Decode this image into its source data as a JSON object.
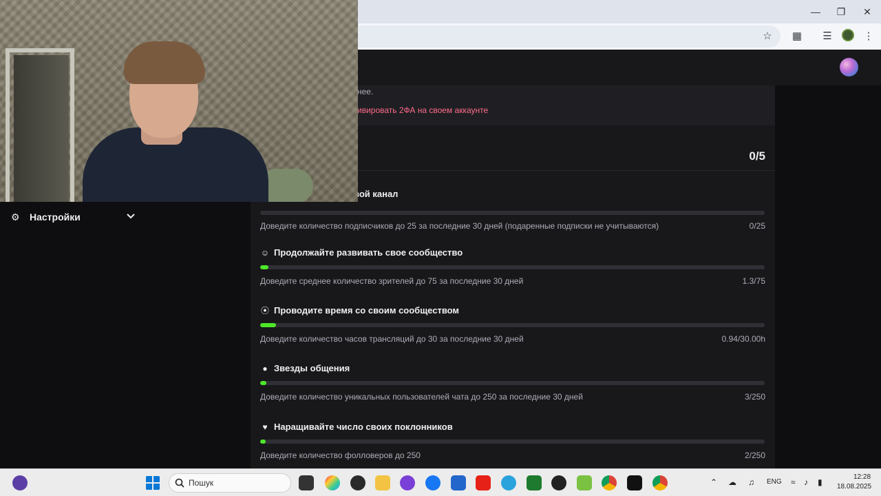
{
  "prev_section": {
    "text_fragment": "нее.",
    "link_fragment": "ивировать 2ФА на своем аккаунте"
  },
  "section": {
    "title_fragment": "вой канал",
    "score": "0/5"
  },
  "goals": [
    {
      "title": "",
      "desc": "Доведите количество подписчиков до 25 за последние 30 дней (подаренные подписки не учитываются)",
      "count": "0/25",
      "progress": 0.0,
      "icon": "none"
    },
    {
      "title": "Продолжайте развивать свое сообщество",
      "desc": "Доведите среднее количество зрителей до 75 за последние 30 дней",
      "count": "1.3/75",
      "progress": 0.017,
      "icon": "community-icon"
    },
    {
      "title": "Проводите время со своим сообществом",
      "desc": "Доведите количество часов трансляций до 30 за последние 30 дней",
      "count": "0.94/30.00h",
      "progress": 0.031,
      "icon": "broadcast-icon"
    },
    {
      "title": "Звезды общения",
      "desc": "Доведите количество уникальных пользователей чата до 250 за последние 30 дней",
      "count": "3/250",
      "progress": 0.012,
      "icon": "chat-icon"
    },
    {
      "title": "Наращивайте число своих поклонников",
      "desc": "Доведите количество фолловеров до 250",
      "count": "2/250",
      "progress": 0.008,
      "icon": "heart-icon"
    }
  ],
  "sidebar": {
    "settings_label": "Настройки"
  },
  "taskbar": {
    "search_label": "Пошук",
    "lang": "ENG",
    "time": "12:28",
    "date": "18.08.2025"
  },
  "colors": {
    "accent_progress": "#4de829",
    "link": "#ff6b8b"
  }
}
